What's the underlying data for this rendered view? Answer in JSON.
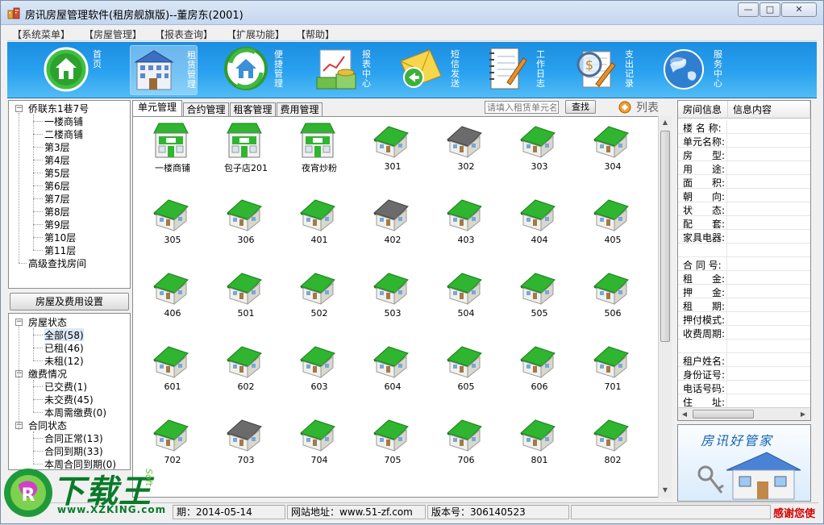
{
  "window": {
    "title": "房讯房屋管理软件(租房舰旗版)--董房东(2001)",
    "controls": {
      "minimize": "—",
      "maximize": "□",
      "close": "✕"
    }
  },
  "menu": [
    "【系统菜单】",
    "【房屋管理】",
    "【报表查询】",
    "【扩展功能】",
    "【帮助】"
  ],
  "toolbar": [
    {
      "label": "首页",
      "icon": "home-icon"
    },
    {
      "label": "租赁管理",
      "icon": "building-icon"
    },
    {
      "label": "便捷管理",
      "icon": "recycle-house-icon"
    },
    {
      "label": "报表中心",
      "icon": "chart-money-icon"
    },
    {
      "label": "短信发送",
      "icon": "envelope-icon"
    },
    {
      "label": "工作日志",
      "icon": "notebook-pen-icon"
    },
    {
      "label": "支出记录",
      "icon": "magnifier-receipt-icon"
    },
    {
      "label": "服务中心",
      "icon": "globe-icon"
    }
  ],
  "building_tree": {
    "root": "侨联东1巷7号",
    "children": [
      "一楼商铺",
      "二楼商铺",
      "第3层",
      "第4层",
      "第5层",
      "第6层",
      "第7层",
      "第8层",
      "第9层",
      "第10层",
      "第11层"
    ],
    "extra": "高级查找房间"
  },
  "settings_button": "房屋及费用设置",
  "filter_tree": {
    "groups": [
      {
        "label": "房屋状态",
        "items": [
          "全部(58)",
          "已租(46)",
          "未租(12)"
        ]
      },
      {
        "label": "缴费情况",
        "items": [
          "已交费(1)",
          "未交费(45)",
          "本周需缴费(0)"
        ]
      },
      {
        "label": "合同状态",
        "items": [
          "合同正常(13)",
          "合同到期(33)",
          "本周合同到期(0)"
        ]
      }
    ]
  },
  "tabs": [
    "单元管理",
    "合约管理",
    "租客管理",
    "费用管理"
  ],
  "search": {
    "placeholder": "请填入租赁单元名",
    "button": "查找"
  },
  "view_toggle": "列表",
  "rooms": [
    {
      "name": "一楼商铺",
      "type": "shop",
      "status": "rented"
    },
    {
      "name": "包子店201",
      "type": "shop",
      "status": "rented"
    },
    {
      "name": "夜宵炒粉",
      "type": "shop",
      "status": "rented"
    },
    {
      "name": "301",
      "type": "house",
      "status": "rented"
    },
    {
      "name": "302",
      "type": "house",
      "status": "vacant"
    },
    {
      "name": "303",
      "type": "house",
      "status": "rented"
    },
    {
      "name": "304",
      "type": "house",
      "status": "rented"
    },
    {
      "name": "305",
      "type": "house",
      "status": "rented"
    },
    {
      "name": "306",
      "type": "house",
      "status": "rented"
    },
    {
      "name": "401",
      "type": "house",
      "status": "rented"
    },
    {
      "name": "402",
      "type": "house",
      "status": "vacant"
    },
    {
      "name": "403",
      "type": "house",
      "status": "rented"
    },
    {
      "name": "404",
      "type": "house",
      "status": "rented"
    },
    {
      "name": "405",
      "type": "house",
      "status": "rented"
    },
    {
      "name": "406",
      "type": "house",
      "status": "rented"
    },
    {
      "name": "501",
      "type": "house",
      "status": "rented"
    },
    {
      "name": "502",
      "type": "house",
      "status": "rented"
    },
    {
      "name": "503",
      "type": "house",
      "status": "rented"
    },
    {
      "name": "504",
      "type": "house",
      "status": "rented"
    },
    {
      "name": "505",
      "type": "house",
      "status": "rented"
    },
    {
      "name": "506",
      "type": "house",
      "status": "rented"
    },
    {
      "name": "601",
      "type": "house",
      "status": "rented"
    },
    {
      "name": "602",
      "type": "house",
      "status": "rented"
    },
    {
      "name": "603",
      "type": "house",
      "status": "rented"
    },
    {
      "name": "604",
      "type": "house",
      "status": "rented"
    },
    {
      "name": "605",
      "type": "house",
      "status": "rented"
    },
    {
      "name": "606",
      "type": "house",
      "status": "rented"
    },
    {
      "name": "701",
      "type": "house",
      "status": "rented"
    },
    {
      "name": "702",
      "type": "house",
      "status": "rented"
    },
    {
      "name": "703",
      "type": "house",
      "status": "vacant"
    },
    {
      "name": "704",
      "type": "house",
      "status": "rented"
    },
    {
      "name": "705",
      "type": "house",
      "status": "rented"
    },
    {
      "name": "706",
      "type": "house",
      "status": "rented"
    },
    {
      "name": "801",
      "type": "house",
      "status": "rented"
    },
    {
      "name": "802",
      "type": "house",
      "status": "rented"
    }
  ],
  "colors": {
    "rented": "#2fb52f",
    "vacant": "#6b6b6b",
    "toolbar": "#2aa2f0",
    "thanks": "#d40000"
  },
  "info_panel": {
    "headers": [
      "房间信息",
      "信息内容"
    ],
    "fields": [
      "楼 名 称:",
      "单元名称:",
      "房　　型:",
      "用　　途:",
      "面　　积:",
      "朝　　向:",
      "状　　态:",
      "配　　套:",
      "家具电器:",
      "",
      "合 同 号:",
      "租　　金:",
      "押　　金:",
      "租　　期:",
      "押付模式:",
      "收费周期:",
      "",
      "租户姓名:",
      "身份证号:",
      "电话号码:",
      "住　　址:"
    ]
  },
  "banner": {
    "text": "房讯好管家"
  },
  "status": {
    "date": "期：2014-05-14",
    "website": "网站地址：www.51-zf.com",
    "version": "版本号：306140523",
    "thanks": "感谢您使"
  },
  "watermark": {
    "main": "下载王",
    "url": "www.XZKING.com",
    "soft": "Soft"
  }
}
